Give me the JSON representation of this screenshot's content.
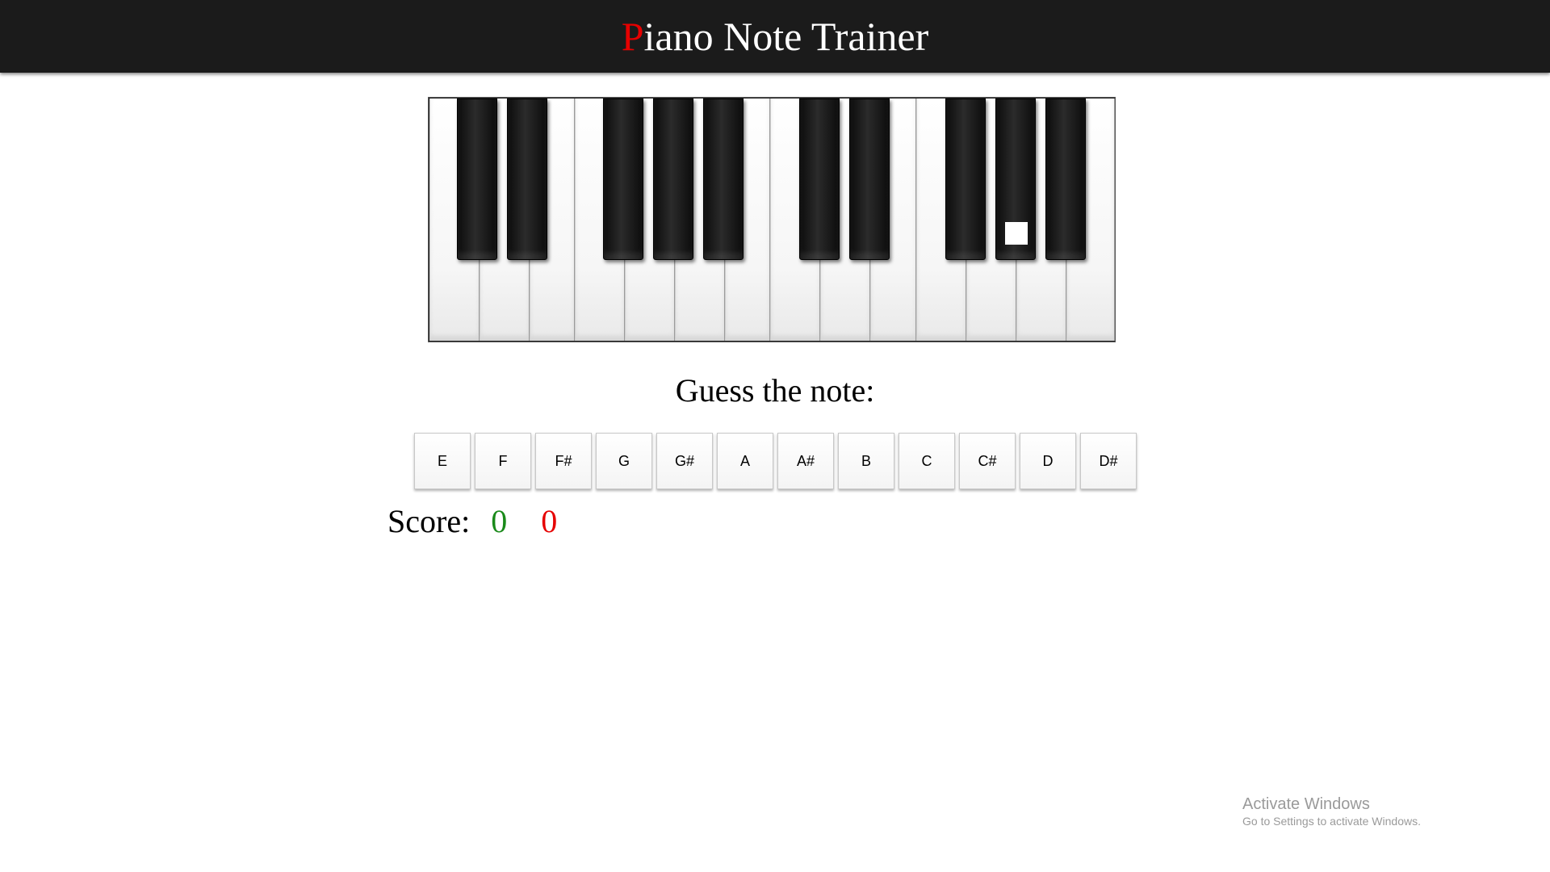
{
  "header": {
    "title_first_letter": "P",
    "title_rest": "iano Note Trainer",
    "accent_color": "#e60000",
    "background_color": "#1b1b1b"
  },
  "piano": {
    "white_keys": [
      "E",
      "F",
      "G",
      "A",
      "B",
      "C",
      "D",
      "E",
      "F",
      "G",
      "A",
      "B",
      "C",
      "D"
    ],
    "black_keys": [
      "F#",
      "G#",
      "A#",
      "C#",
      "D#",
      "F#",
      "G#",
      "A#",
      "C#",
      "D#"
    ],
    "highlighted_key": "C#"
  },
  "prompt": {
    "text": "Guess the note:"
  },
  "answers": [
    "E",
    "F",
    "F#",
    "G",
    "G#",
    "A",
    "A#",
    "B",
    "C",
    "C#",
    "D",
    "D#"
  ],
  "score": {
    "label": "Score:",
    "correct": "0",
    "wrong": "0",
    "correct_color": "#1a8a1a",
    "wrong_color": "#e60000"
  },
  "watermark": {
    "title": "Activate Windows",
    "subtitle": "Go to Settings to activate Windows."
  }
}
